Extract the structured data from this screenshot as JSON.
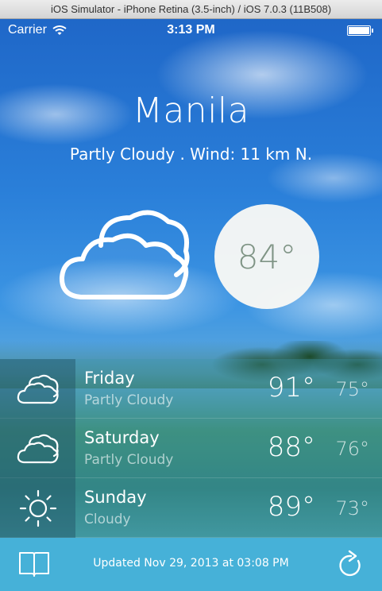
{
  "window": {
    "title": "iOS Simulator - iPhone Retina (3.5-inch) / iOS 7.0.3 (11B508)"
  },
  "status_bar": {
    "carrier": "Carrier",
    "time": "3:13 PM",
    "battery_level": 1.0
  },
  "current": {
    "city": "Manila",
    "conditions": "Partly Cloudy . Wind: 11 km N.",
    "icon": "cloud-icon",
    "temperature": "84°"
  },
  "forecast": [
    {
      "day": "Friday",
      "condition": "Partly Cloudy",
      "high": "91°",
      "low": "75°",
      "icon": "cloud-icon"
    },
    {
      "day": "Saturday",
      "condition": "Partly Cloudy",
      "high": "88°",
      "low": "76°",
      "icon": "cloud-icon"
    },
    {
      "day": "Sunday",
      "condition": "Cloudy",
      "high": "89°",
      "low": "73°",
      "icon": "sun-icon"
    }
  ],
  "toolbar": {
    "left_icon": "book-icon",
    "updated": "Updated Nov 29, 2013 at 03:08 PM",
    "right_icon": "refresh-icon"
  }
}
